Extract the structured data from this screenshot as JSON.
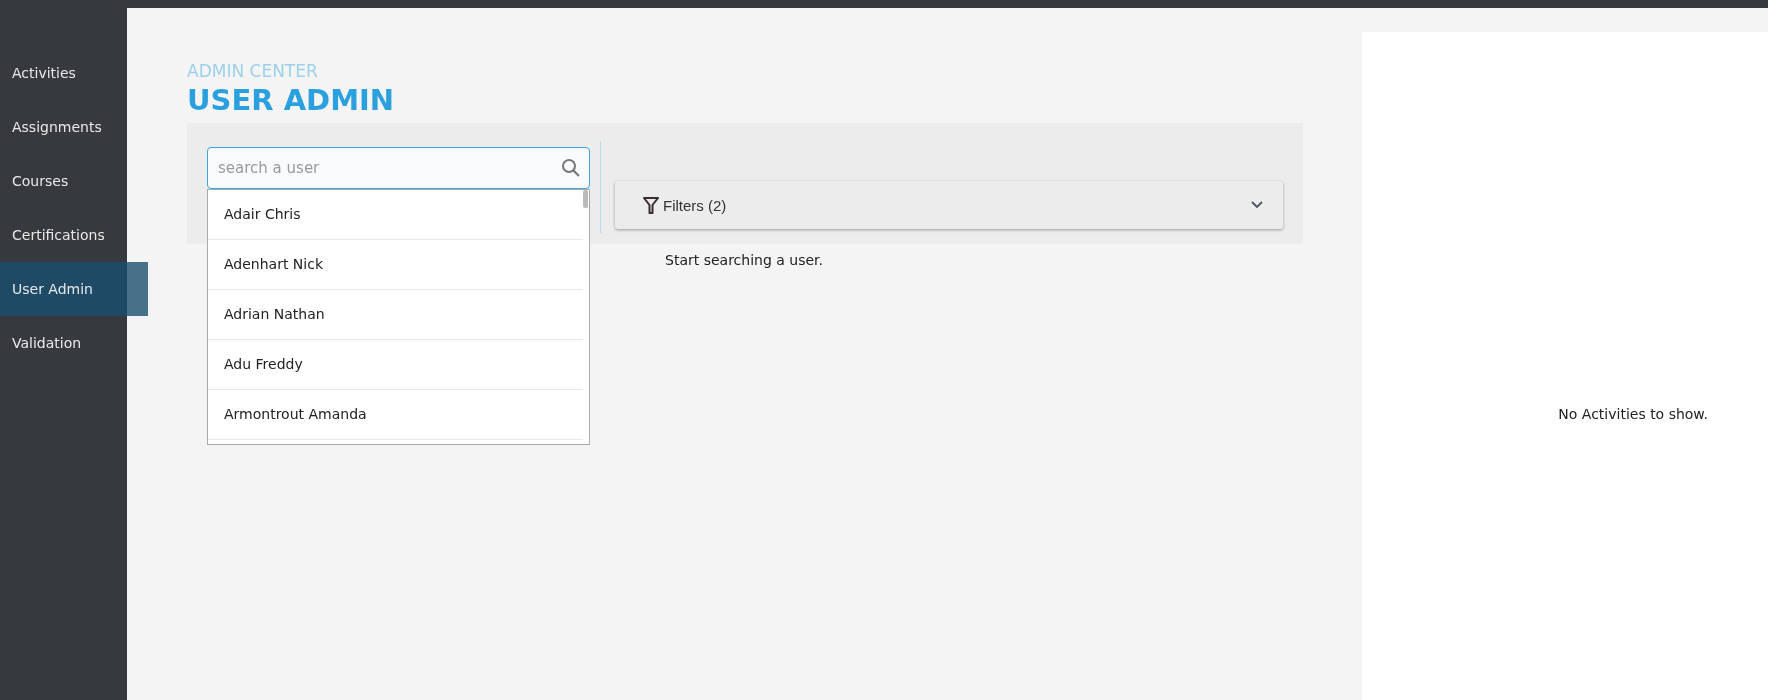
{
  "sidebar": {
    "items": [
      {
        "label": "Activities",
        "selected": false
      },
      {
        "label": "Assignments",
        "selected": false
      },
      {
        "label": "Courses",
        "selected": false
      },
      {
        "label": "Certifications",
        "selected": false
      },
      {
        "label": "User Admin",
        "selected": true
      },
      {
        "label": "Validation",
        "selected": false
      }
    ]
  },
  "header": {
    "subtitle": "ADMIN CENTER",
    "title": "USER ADMIN"
  },
  "search": {
    "placeholder": "search a user",
    "suggestions": [
      "Adair Chris",
      "Adenhart Nick",
      "Adrian Nathan",
      "Adu Freddy",
      "Armontrout Amanda"
    ]
  },
  "filters": {
    "label": "Filters (2)",
    "expanded": false
  },
  "empty_message": "Start searching a user.",
  "activities_panel": {
    "empty_message": "No Activities to show."
  }
}
